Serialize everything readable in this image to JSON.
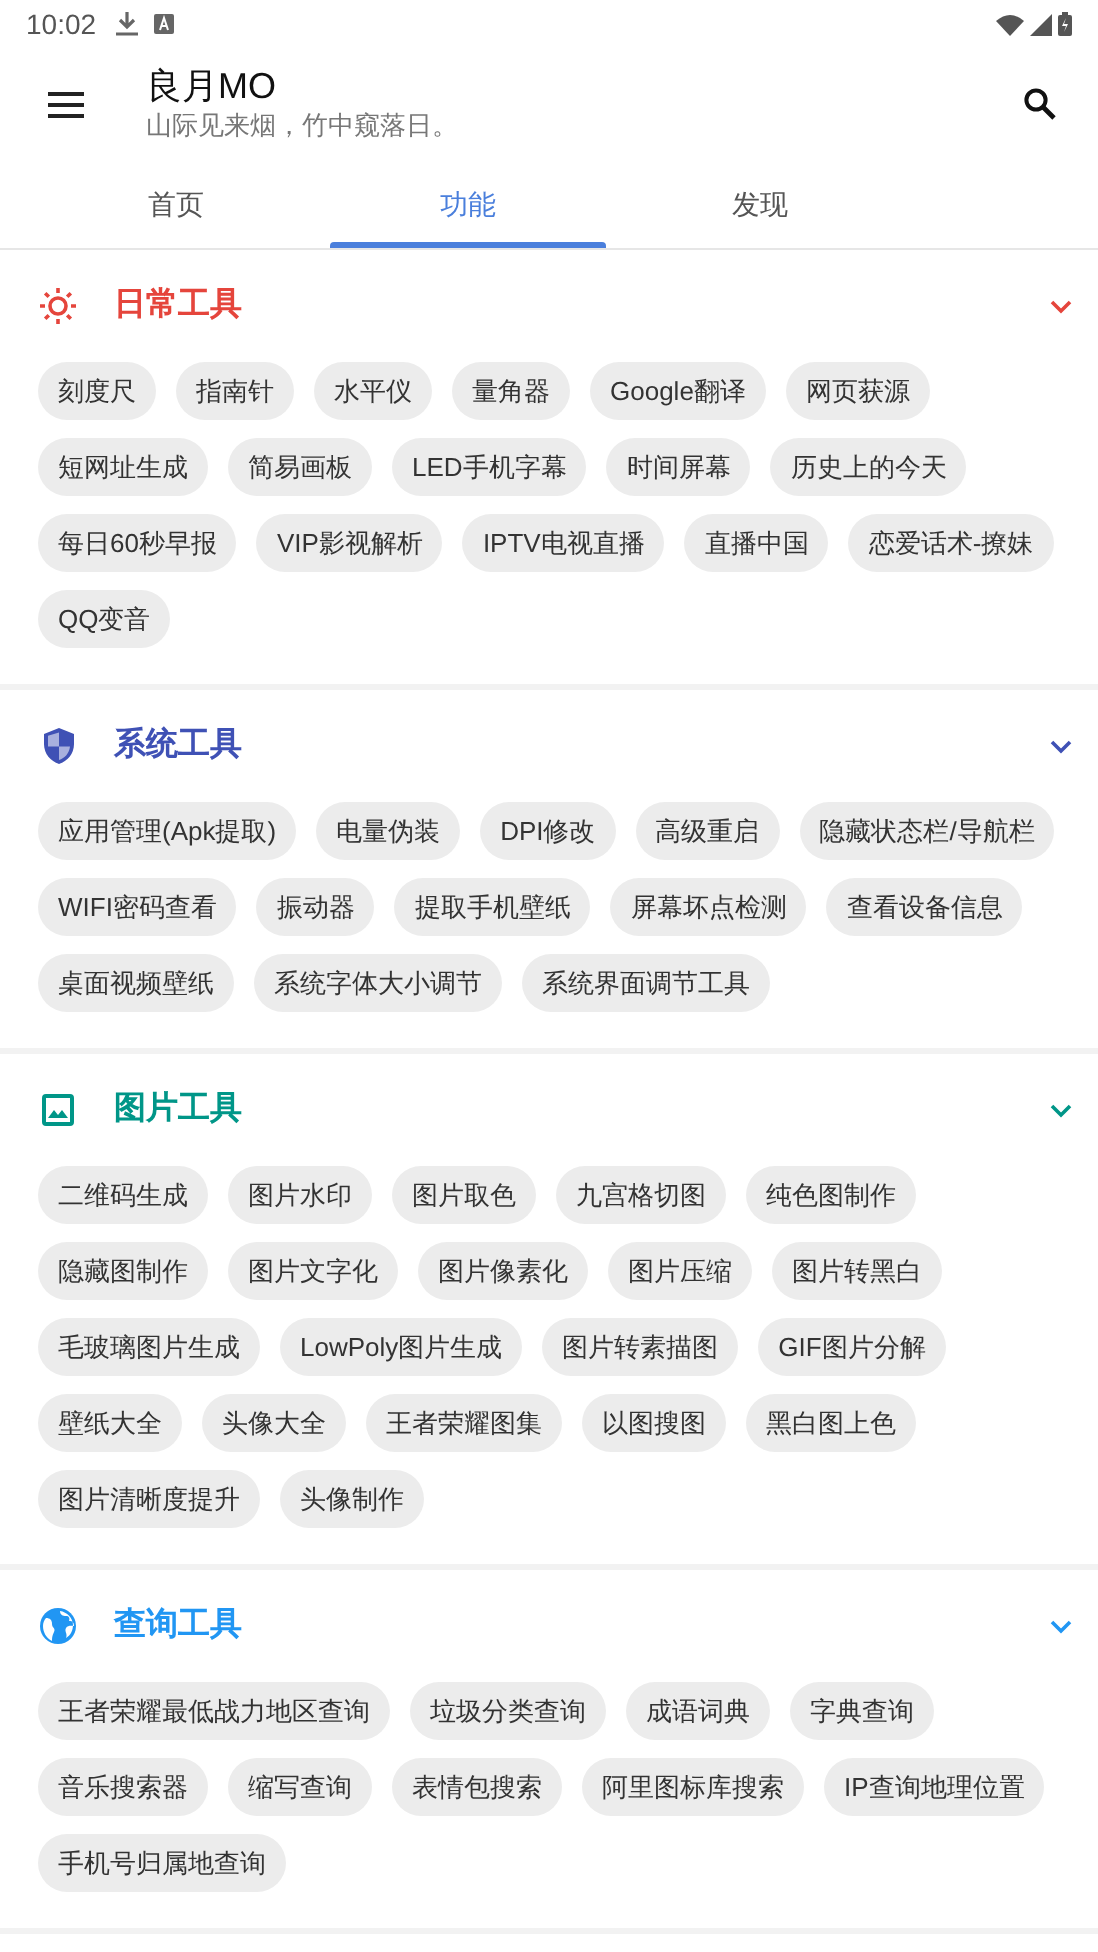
{
  "status_bar": {
    "time": "10:02"
  },
  "app_bar": {
    "title": "良月MO",
    "subtitle": "山际见来烟，竹中窥落日。"
  },
  "tabs": [
    {
      "label": "首页",
      "selected": false
    },
    {
      "label": "功能",
      "selected": true
    },
    {
      "label": "发现",
      "selected": false
    }
  ],
  "sections": [
    {
      "title": "日常工具",
      "kind": "sun",
      "color": "#e5453c",
      "items": [
        "刻度尺",
        "指南针",
        "水平仪",
        "量角器",
        "Google翻译",
        "网页获源",
        "短网址生成",
        "简易画板",
        "LED手机字幕",
        "时间屏幕",
        "历史上的今天",
        "每日60秒早报",
        "VIP影视解析",
        "IPTV电视直播",
        "直播中国",
        "恋爱话术-撩妹",
        "QQ变音"
      ]
    },
    {
      "title": "系统工具",
      "kind": "shield",
      "color": "#3f51b5",
      "items": [
        "应用管理(Apk提取)",
        "电量伪装",
        "DPI修改",
        "高级重启",
        "隐藏状态栏/导航栏",
        "WIFI密码查看",
        "振动器",
        "提取手机壁纸",
        "屏幕坏点检测",
        "查看设备信息",
        "桌面视频壁纸",
        "系统字体大小调节",
        "系统界面调节工具"
      ]
    },
    {
      "title": "图片工具",
      "kind": "image",
      "color": "#009688",
      "items": [
        "二维码生成",
        "图片水印",
        "图片取色",
        "九宫格切图",
        "纯色图制作",
        "隐藏图制作",
        "图片文字化",
        "图片像素化",
        "图片压缩",
        "图片转黑白",
        "毛玻璃图片生成",
        "LowPoly图片生成",
        "图片转素描图",
        "GIF图片分解",
        "壁纸大全",
        "头像大全",
        "王者荣耀图集",
        "以图搜图",
        "黑白图上色",
        "图片清晰度提升",
        "头像制作"
      ]
    },
    {
      "title": "查询工具",
      "kind": "globe",
      "color": "#2196f3",
      "items": [
        "王者荣耀最低战力地区查询",
        "垃圾分类查询",
        "成语词典",
        "字典查询",
        "音乐搜索器",
        "缩写查询",
        "表情包搜索",
        "阿里图标库搜索",
        "IP查询地理位置",
        "手机号归属地查询"
      ]
    }
  ]
}
